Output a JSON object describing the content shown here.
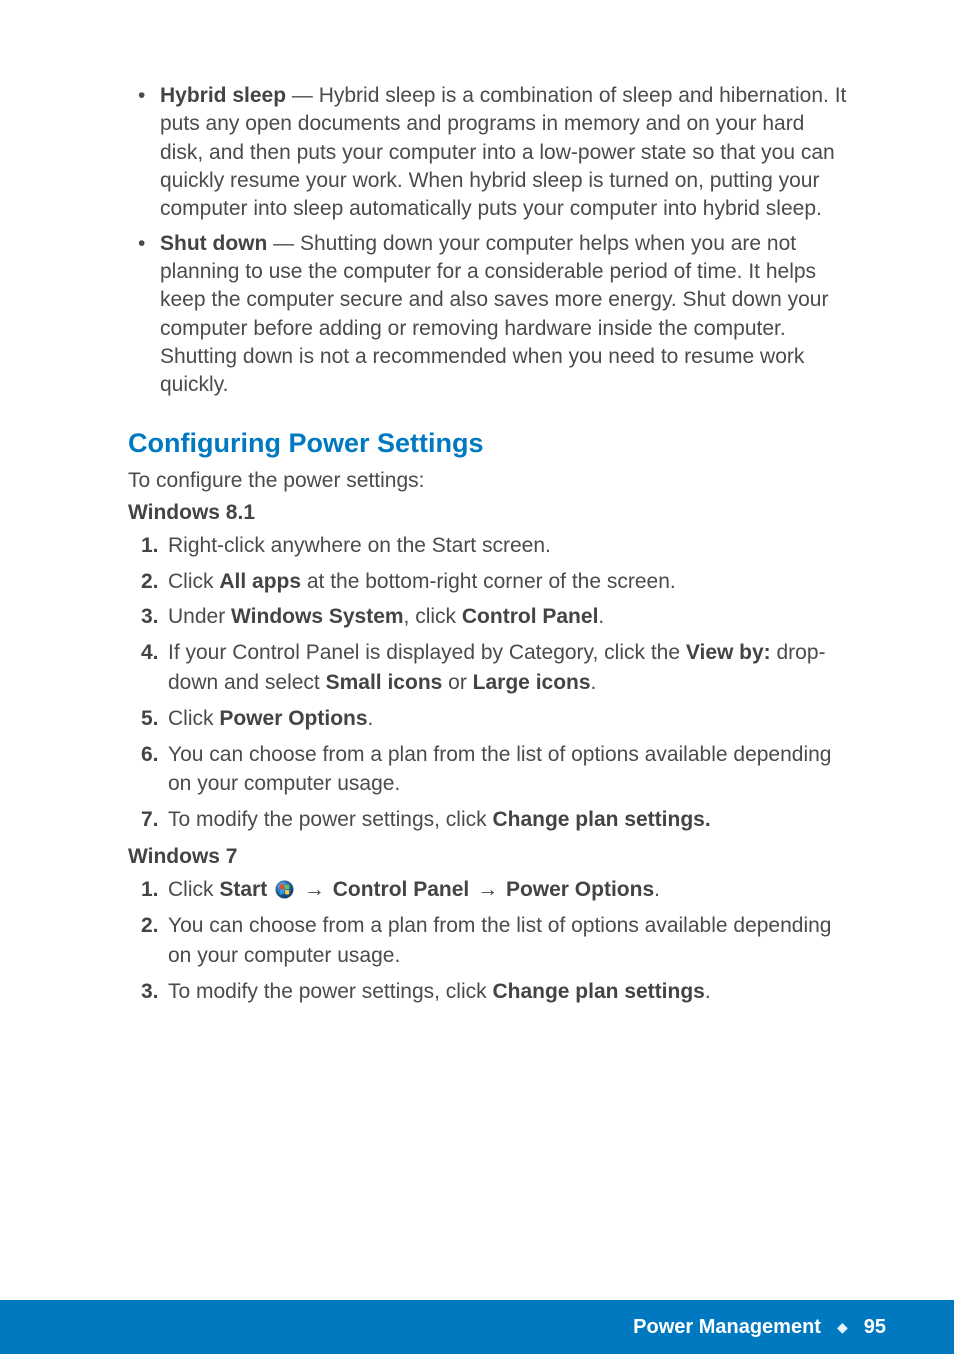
{
  "bullets": {
    "hybrid": {
      "label": "Hybrid sleep",
      "text": " — Hybrid sleep is a combination of sleep and hibernation. It puts any open documents and programs in memory and on your hard disk, and then puts your computer into a low-power state so that you can quickly resume your work. When hybrid sleep is turned on, putting your computer into sleep automatically puts your computer into hybrid sleep."
    },
    "shutdown": {
      "label": "Shut down",
      "text": " — Shutting down your computer helps when you are not planning to use the computer for a considerable period of time. It helps keep the computer secure and also saves more energy. Shut down your computer before adding or removing hardware inside the computer. Shutting down is not a recommended when you need to resume work quickly."
    }
  },
  "section_heading": "Configuring Power Settings",
  "intro": "To configure the power settings:",
  "win81_heading": "Windows 8.1",
  "win81_steps": {
    "s1": {
      "num": "1.",
      "text": "Right-click anywhere on the Start screen."
    },
    "s2": {
      "num": "2.",
      "pre": "Click ",
      "b1": "All apps",
      "post": " at the bottom-right corner of the screen."
    },
    "s3": {
      "num": "3.",
      "pre": "Under ",
      "b1": "Windows System",
      "mid": ", click ",
      "b2": "Control Panel",
      "post": "."
    },
    "s4": {
      "num": "4.",
      "pre": "If your Control Panel is displayed by Category, click the ",
      "b1": "View by:",
      "mid": " drop-down and select ",
      "b2": "Small icons",
      "mid2": " or ",
      "b3": "Large icons",
      "post": "."
    },
    "s5": {
      "num": "5.",
      "pre": "Click ",
      "b1": "Power Options",
      "post": "."
    },
    "s6": {
      "num": "6.",
      "text": "You can choose from a plan from the list of options available depending on your computer usage."
    },
    "s7": {
      "num": "7.",
      "pre": "To modify the power settings, click ",
      "b1": "Change plan settings."
    }
  },
  "win7_heading": "Windows 7",
  "win7_steps": {
    "s1": {
      "num": "1.",
      "pre": "Click ",
      "b1": "Start",
      "arrow1": "→",
      "b2": "Control Panel",
      "arrow2": "→",
      "b3": "Power Options",
      "post": "."
    },
    "s2": {
      "num": "2.",
      "text": "You can choose from a plan from the list of options available depending on your computer usage."
    },
    "s3": {
      "num": "3.",
      "pre": "To modify the power settings, click ",
      "b1": "Change plan settings",
      "post": "."
    }
  },
  "footer": {
    "chapter": "Power Management",
    "diamond": "◆",
    "page": "95"
  }
}
